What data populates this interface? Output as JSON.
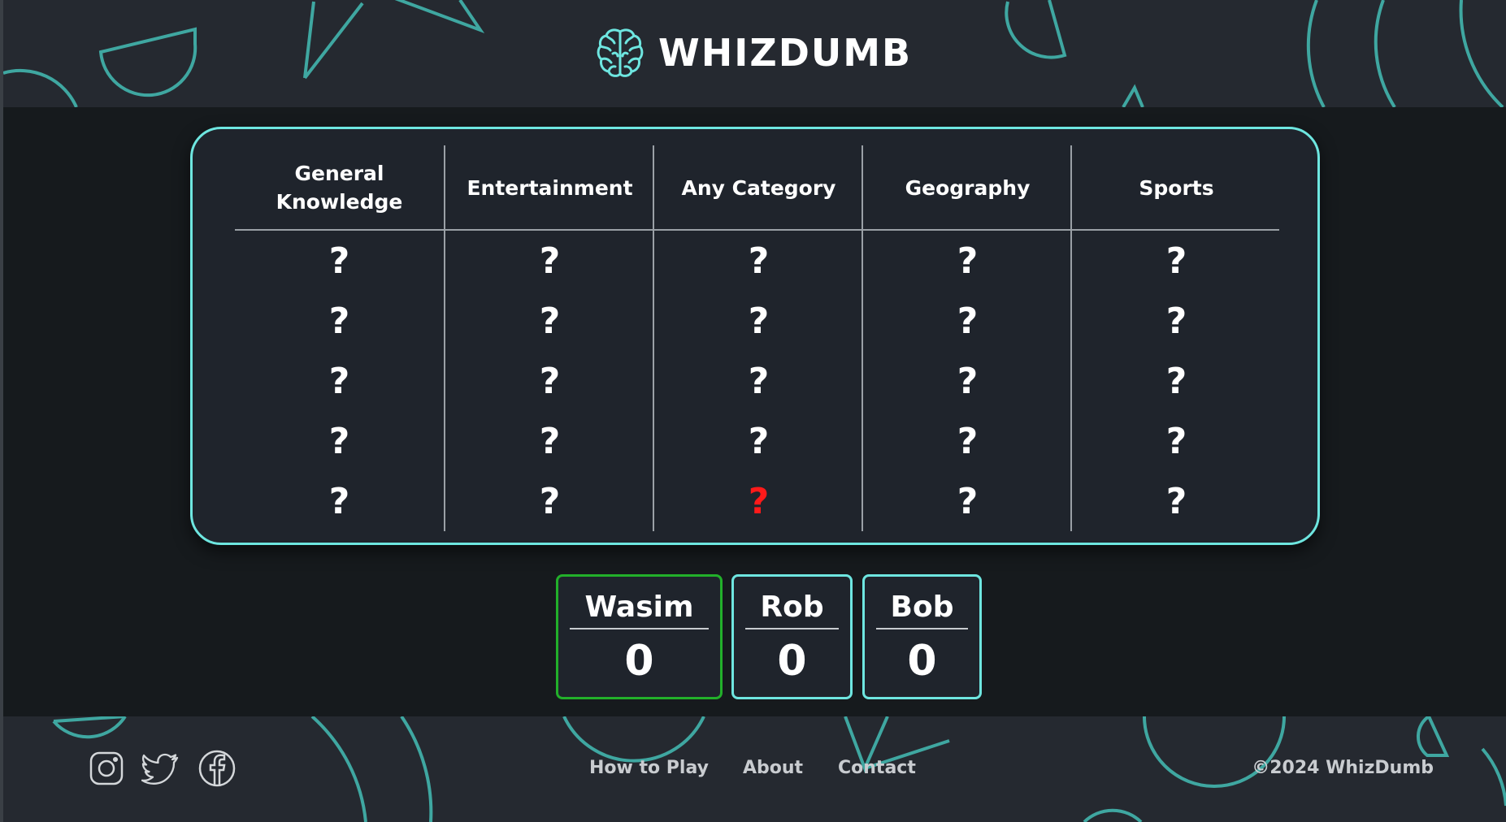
{
  "header": {
    "title": "WHIZDUMB",
    "logo_icon": "brain-icon"
  },
  "colors": {
    "accent": "#6ee6e0",
    "active_player": "#22b02a",
    "selected_tile": "#ff1a1a",
    "panel": "#1f242c",
    "background": "#161a1d"
  },
  "board": {
    "categories": [
      {
        "label": "General Knowledge",
        "tiles": [
          "?",
          "?",
          "?",
          "?",
          "?"
        ]
      },
      {
        "label": "Entertainment",
        "tiles": [
          "?",
          "?",
          "?",
          "?",
          "?"
        ]
      },
      {
        "label": "Any Category",
        "tiles": [
          "?",
          "?",
          "?",
          "?",
          "?"
        ]
      },
      {
        "label": "Geography",
        "tiles": [
          "?",
          "?",
          "?",
          "?",
          "?"
        ]
      },
      {
        "label": "Sports",
        "tiles": [
          "?",
          "?",
          "?",
          "?",
          "?"
        ]
      }
    ],
    "highlighted_tile": {
      "category": 2,
      "row": 4
    }
  },
  "players": [
    {
      "name": "Wasim",
      "score": "0",
      "current": true
    },
    {
      "name": "Rob",
      "score": "0",
      "current": false
    },
    {
      "name": "Bob",
      "score": "0",
      "current": false
    }
  ],
  "footer": {
    "social_icons": [
      "instagram-icon",
      "twitter-icon",
      "facebook-icon"
    ],
    "links": [
      "How to Play",
      "About",
      "Contact"
    ],
    "copyright": "©2024 WhizDumb"
  }
}
